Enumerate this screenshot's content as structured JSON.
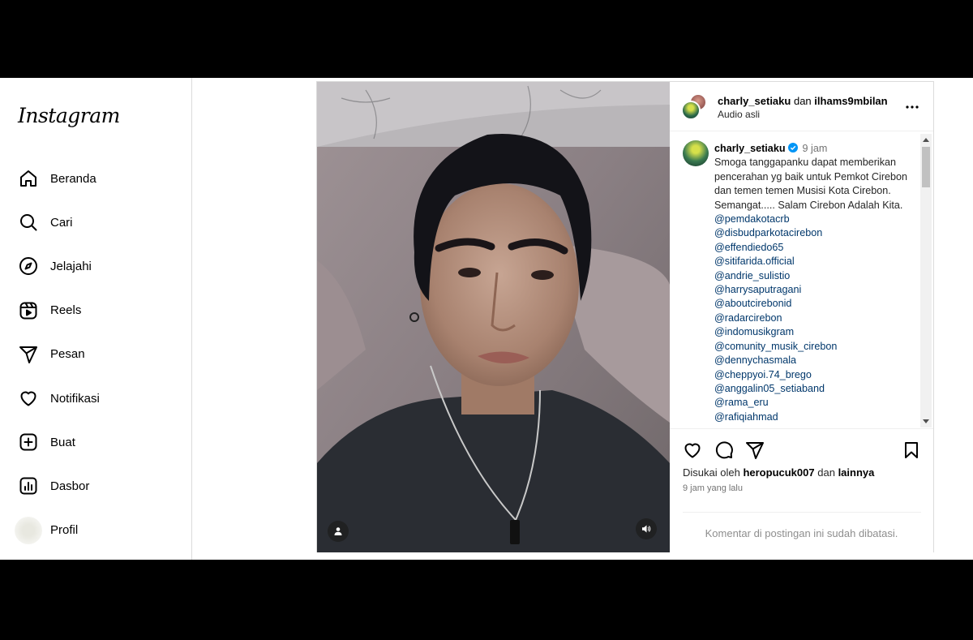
{
  "app": {
    "logo": "Instagram"
  },
  "nav": [
    {
      "label": "Beranda",
      "icon": "home-icon"
    },
    {
      "label": "Cari",
      "icon": "search-icon"
    },
    {
      "label": "Jelajahi",
      "icon": "explore-icon"
    },
    {
      "label": "Reels",
      "icon": "reels-icon"
    },
    {
      "label": "Pesan",
      "icon": "send-icon"
    },
    {
      "label": "Notifikasi",
      "icon": "heart-icon"
    },
    {
      "label": "Buat",
      "icon": "plus-square-icon"
    },
    {
      "label": "Dasbor",
      "icon": "dashboard-icon"
    },
    {
      "label": "Profil",
      "icon": "avatar"
    }
  ],
  "post": {
    "header": {
      "user1": "charly_setiaku",
      "joiner": "dan",
      "user2": "ilhams9mbilan",
      "audio": "Audio asli"
    },
    "caption": {
      "username": "charly_setiaku",
      "time": "9 jam",
      "text": "Smoga tanggapanku dapat memberikan pencerahan yg baik untuk Pemkot Cirebon dan temen temen Musisi Kota Cirebon. Semangat..... Salam Cirebon Adalah Kita.",
      "mentions": [
        "@pemdakotacrb",
        "@disbudparkotacirebon",
        "@effendiedo65",
        "@sitifarida.official",
        "@andrie_sulistio",
        "@harrysaputragani",
        "@aboutcirebonid",
        "@radarcirebon",
        "@indomusikgram",
        "@comunity_musik_cirebon",
        "@dennychasmala",
        "@cheppyoi.74_brego",
        "@anggalin05_setiaband",
        "@rama_eru",
        "@rafiqiahmad"
      ]
    },
    "likes": {
      "prefix": "Disukai oleh",
      "user": "heropucuk007",
      "joiner": "dan",
      "others": "lainnya"
    },
    "ago": "9 jam yang lalu",
    "comments_restricted": "Komentar di postingan ini sudah dibatasi."
  }
}
